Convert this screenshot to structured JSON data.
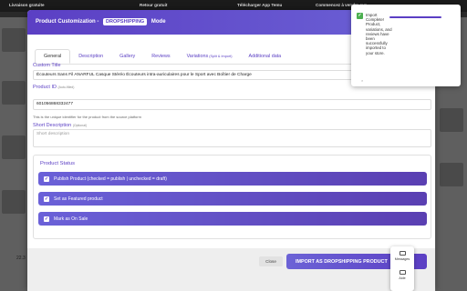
{
  "background": {
    "topbar": [
      "Livraison gratuite",
      "Retour gratuit",
      "Télécharger App Temu",
      "Commencez à vendre sur..."
    ],
    "bottom_text": "22.3"
  },
  "modal": {
    "title_prefix": "Product Customization -",
    "mode_badge": "DROPSHIPPING",
    "title_suffix": "Mode",
    "tabs": [
      {
        "label": "General",
        "note": ""
      },
      {
        "label": "Description",
        "note": ""
      },
      {
        "label": "Gallery",
        "note": ""
      },
      {
        "label": "Reviews",
        "note": ""
      },
      {
        "label": "Variations",
        "note": "(Split & Import)"
      },
      {
        "label": "Additional data",
        "note": ""
      }
    ],
    "custom_title": {
      "label": "Custom Title",
      "value": "Écouteurs Sans Fil ANARFUL Casque Stéréo Écouteurs intra-auriculaires pour le Sport avec Boîtier de Charge"
    },
    "product_id": {
      "label": "Product ID",
      "label_note": "(Auto-filled)",
      "value": "601056868332477",
      "hint": "This is the unique identifier for the product from the source platform"
    },
    "short_description": {
      "label": "Short Description",
      "label_note": "(Optional)",
      "placeholder": "Short description"
    },
    "status": {
      "title": "Product Status",
      "options": [
        {
          "label": "Publish Product (checked = publish | unchecked = draft)",
          "checked": true
        },
        {
          "label": "Set as Featured product",
          "checked": true
        },
        {
          "label": "Mark as On Sale",
          "checked": true
        }
      ]
    },
    "footer": {
      "close_label": "Close",
      "import_label": "IMPORT AS DROPSHIPPING PRODUCT"
    }
  },
  "toast": {
    "message": "Import Complete! Product, variations, and reviews have been successfully imported to your store.",
    "close_symbol": "×"
  },
  "widget": {
    "messages_label": "Messages",
    "help_label": "Aide"
  },
  "colors": {
    "accent": "#5b3fc4",
    "success": "#4caf50"
  }
}
